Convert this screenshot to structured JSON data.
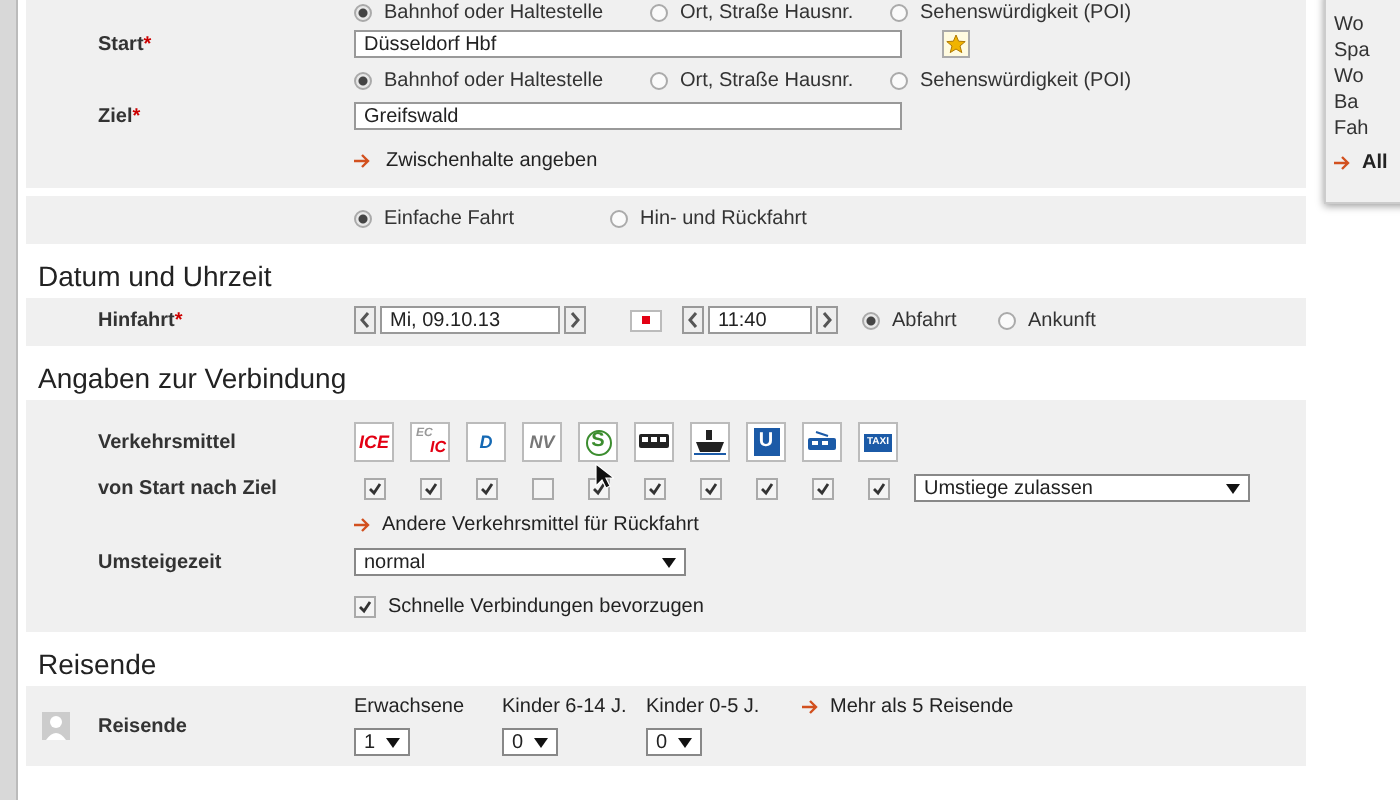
{
  "start": {
    "type_options": [
      {
        "label": "Bahnhof oder Haltestelle",
        "selected": true
      },
      {
        "label": "Ort, Straße Hausnr.",
        "selected": false
      },
      {
        "label": "Sehenswürdigkeit (POI)",
        "selected": false
      }
    ],
    "label": "Start",
    "required_mark": "*",
    "value": "Düsseldorf Hbf"
  },
  "destination": {
    "type_options": [
      {
        "label": "Bahnhof oder Haltestelle",
        "selected": true
      },
      {
        "label": "Ort, Straße Hausnr.",
        "selected": false
      },
      {
        "label": "Sehenswürdigkeit (POI)",
        "selected": false
      }
    ],
    "label": "Ziel",
    "required_mark": "*",
    "value": "Greifswald",
    "stopover_link": "Zwischenhalte angeben"
  },
  "trip_type": [
    {
      "label": "Einfache Fahrt",
      "selected": true
    },
    {
      "label": "Hin- und Rückfahrt",
      "selected": false
    }
  ],
  "date_section": {
    "heading": "Datum und Uhrzeit",
    "label": "Hinfahrt",
    "required_mark": "*",
    "date": "Mi, 09.10.13",
    "time": "11:40",
    "time_mode": [
      {
        "label": "Abfahrt",
        "selected": true
      },
      {
        "label": "Ankunft",
        "selected": false
      }
    ]
  },
  "connection_section": {
    "heading": "Angaben zur Verbindung",
    "transport_label": "Verkehrsmittel",
    "transports": [
      {
        "kind": "ice",
        "labels": [
          "ICE"
        ],
        "checked": true
      },
      {
        "kind": "ecic",
        "labels": [
          "EC",
          "IC"
        ],
        "checked": true
      },
      {
        "kind": "d",
        "labels": [
          "D"
        ],
        "checked": true
      },
      {
        "kind": "nv",
        "labels": [
          "NV"
        ],
        "checked": false
      },
      {
        "kind": "sbahn",
        "labels": [
          "S"
        ],
        "checked": true
      },
      {
        "kind": "bus",
        "checked": true
      },
      {
        "kind": "ship",
        "checked": true
      },
      {
        "kind": "ubahn",
        "labels": [
          "U"
        ],
        "checked": true
      },
      {
        "kind": "tram",
        "checked": true
      },
      {
        "kind": "taxi",
        "labels": [
          "TAXI"
        ],
        "checked": true
      }
    ],
    "route_label": "von Start nach Ziel",
    "changes_select": "Umstiege zulassen",
    "return_link": "Andere Verkehrsmittel für Rückfahrt",
    "transfer_label": "Umsteigezeit",
    "transfer_select": "normal",
    "fast_option": {
      "label": "Schnelle Verbindungen bevorzugen",
      "checked": true
    }
  },
  "travellers_section": {
    "heading": "Reisende",
    "label": "Reisende",
    "groups": [
      {
        "label": "Erwachsene",
        "value": "1"
      },
      {
        "label": "Kinder 6-14 J.",
        "value": "0"
      },
      {
        "label": "Kinder 0-5 J.",
        "value": "0"
      }
    ],
    "more_link": "Mehr als 5 Reisende"
  },
  "side_panel": {
    "items": [
      "Wo",
      "Spa",
      "Wo",
      "Ba",
      "Fah"
    ],
    "footer_link": "All"
  }
}
